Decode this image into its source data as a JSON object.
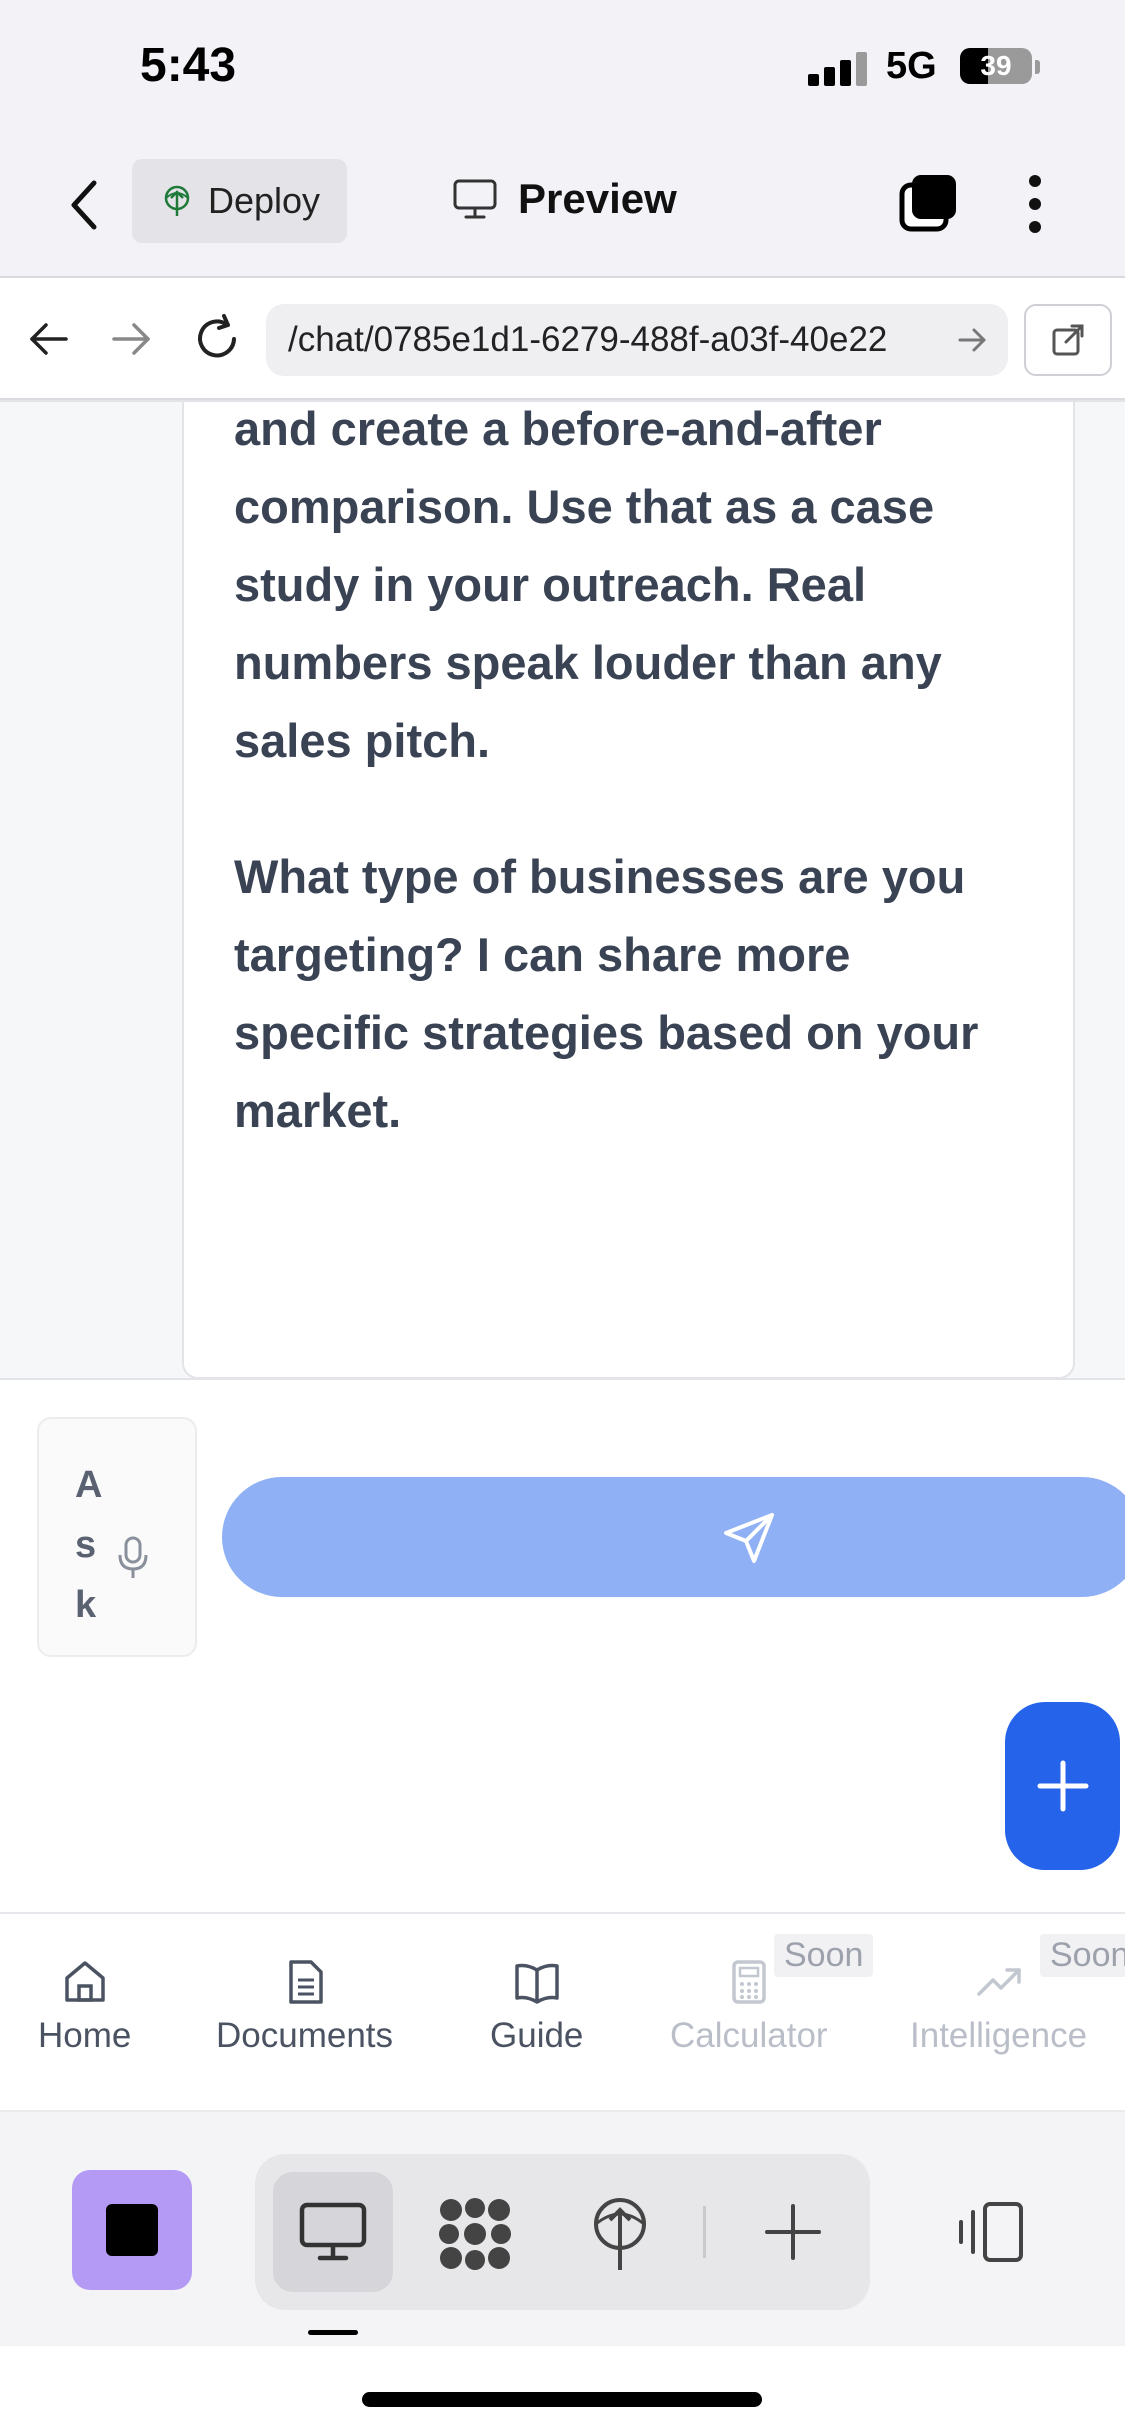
{
  "status_bar": {
    "time": "5:43",
    "network": "5G",
    "battery": "39",
    "battery_level": 0.39
  },
  "header": {
    "back_icon": "chevron-left-icon",
    "deploy_label": "Deploy",
    "preview_label": "Preview",
    "tabs_icon": "tabs-icon",
    "more_icon": "more-vertical-icon"
  },
  "browser": {
    "url": "/chat/0785e1d1-6279-488f-a03f-40e22"
  },
  "chat": {
    "message_paragraphs": [
      "and create a before-and-after comparison. Use that as a case study in your outreach. Real numbers speak louder than any sales pitch.",
      "What type of businesses are you targeting? I can share more specific strategies based on your market."
    ]
  },
  "composer": {
    "placeholder": "Ask",
    "send_icon": "send-icon",
    "add_icon": "plus-icon"
  },
  "bottom_nav": {
    "items": [
      {
        "label": "Home",
        "icon": "home-icon"
      },
      {
        "label": "Documents",
        "icon": "document-icon"
      },
      {
        "label": "Guide",
        "icon": "book-icon"
      },
      {
        "label": "Calculator",
        "icon": "calculator-icon",
        "badge": "Soon"
      },
      {
        "label": "Intelligence",
        "icon": "trending-up-icon",
        "badge": "Soon"
      }
    ]
  },
  "colors": {
    "accent": "#2563eb",
    "send_button": "#8fb0f4",
    "stop_button": "#b49af5",
    "message_text": "#3a4354"
  }
}
